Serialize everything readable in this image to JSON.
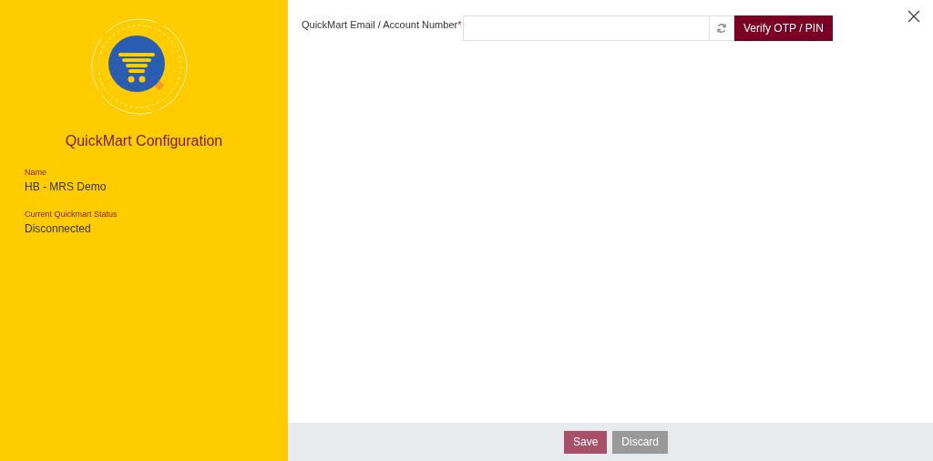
{
  "sidebar": {
    "title": "QuickMart Configuration",
    "fields": [
      {
        "label": "Name",
        "value": "HB - MRS Demo"
      },
      {
        "label": "Current Quickmart Status",
        "value": "Disconnected"
      }
    ]
  },
  "form": {
    "field": {
      "label": "QuickMart Email / Account Number",
      "required_mark": "*"
    },
    "verify_button": "Verify OTP / PIN"
  },
  "footer": {
    "buttons": [
      {
        "label": "Save",
        "kind": "primary"
      },
      {
        "label": "Discard",
        "kind": "secondary"
      }
    ]
  }
}
